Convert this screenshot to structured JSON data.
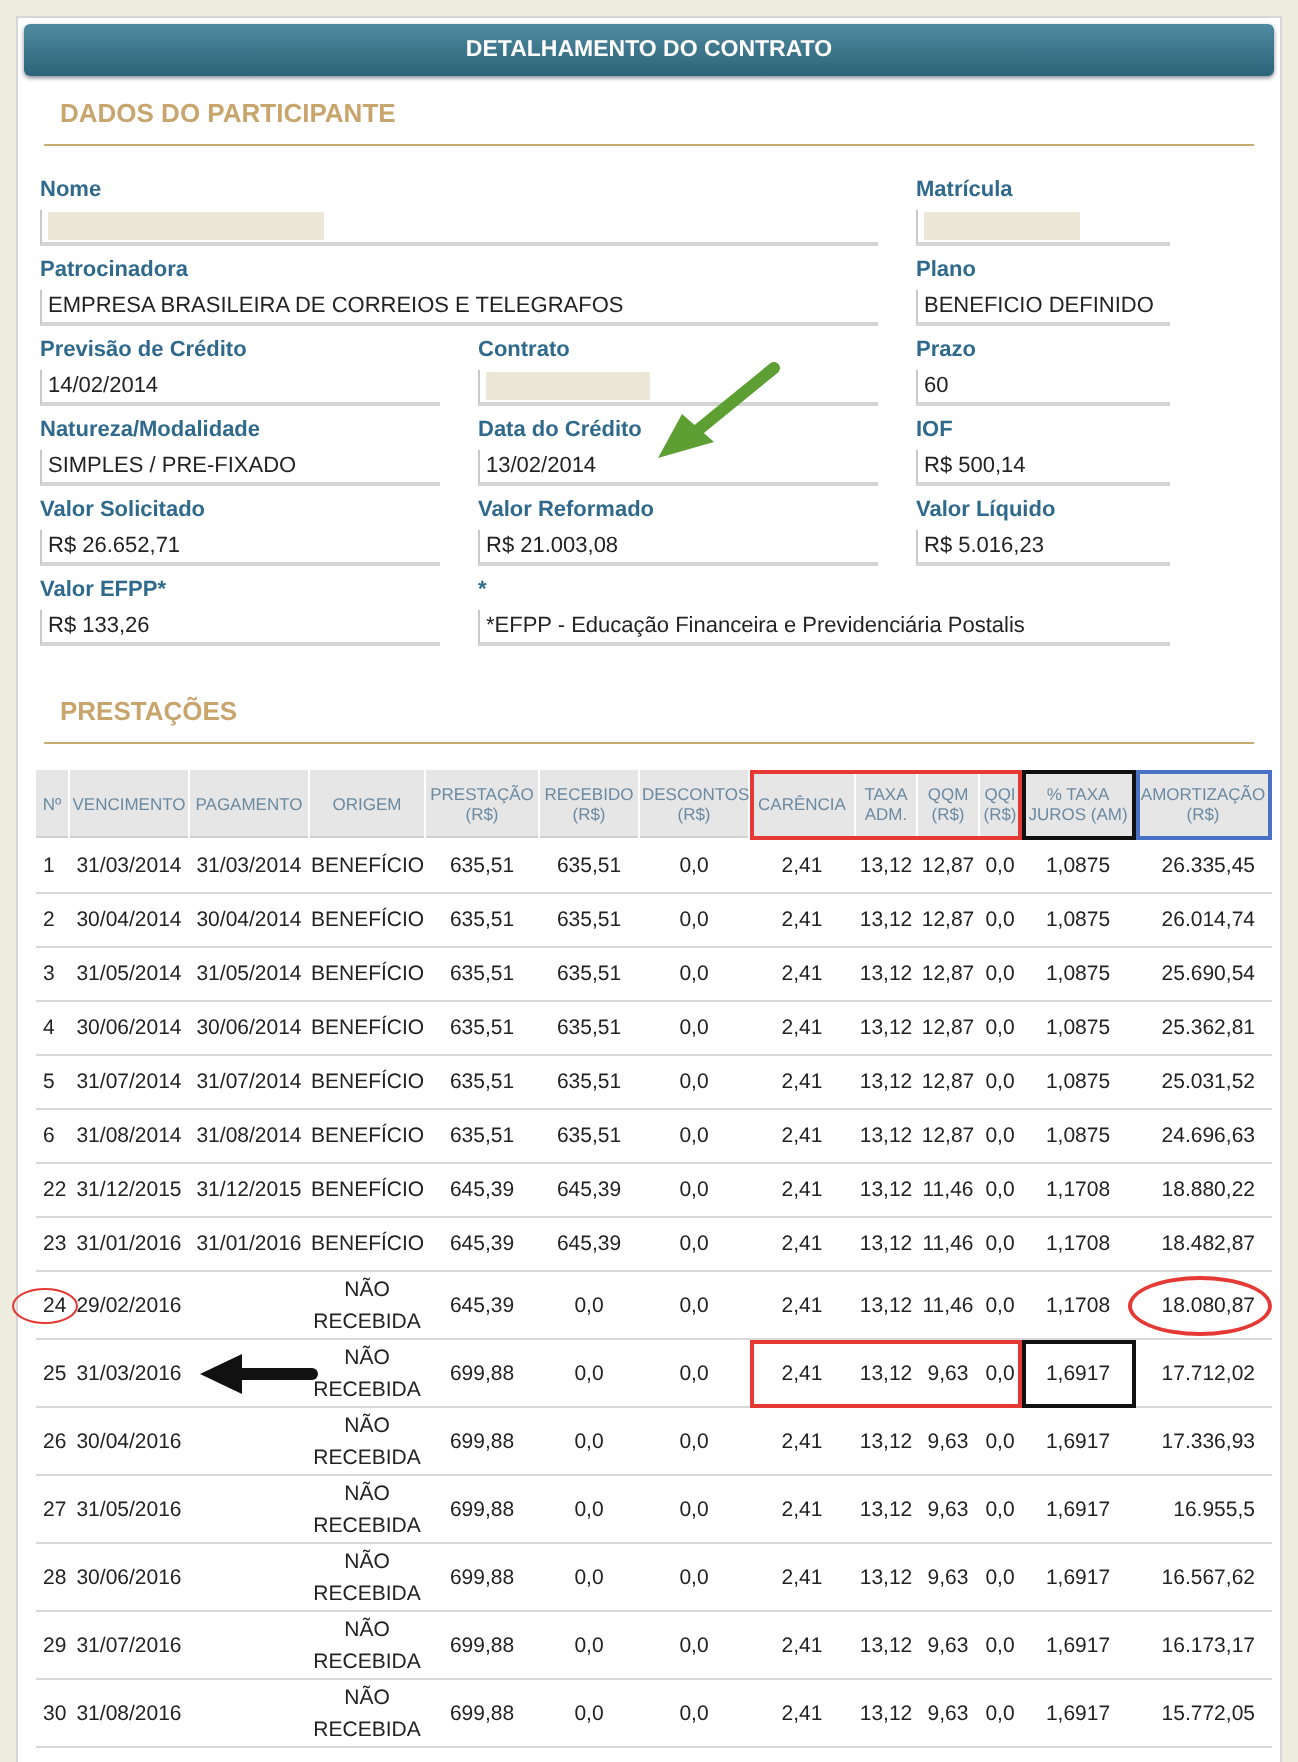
{
  "header": {
    "title": "DETALHAMENTO DO CONTRATO"
  },
  "participant": {
    "title": "DADOS DO PARTICIPANTE",
    "fields": [
      {
        "label": "Nome",
        "kind": "wide",
        "redacted": true
      },
      {
        "label": "Matrícula",
        "kind": "normal",
        "redacted": true
      },
      {
        "label": "Patrocinadora",
        "kind": "wide",
        "value": "EMPRESA BRASILEIRA DE CORREIOS E TELEGRAFOS"
      },
      {
        "label": "Plano",
        "kind": "normal",
        "value": "BENEFICIO DEFINIDO"
      },
      {
        "label": "Previsão de Crédito",
        "kind": "normal",
        "value": "14/02/2014"
      },
      {
        "label": "Contrato",
        "kind": "normal",
        "redacted": true
      },
      {
        "label": "Prazo",
        "kind": "normal",
        "value": "60"
      },
      {
        "label": "Natureza/Modalidade",
        "kind": "normal",
        "value": "SIMPLES / PRE-FIXADO"
      },
      {
        "label": "Data do Crédito",
        "kind": "normal",
        "value": "13/02/2014",
        "marker": {
          "kind": "arrow",
          "color": "#5e9f33"
        }
      },
      {
        "label": "IOF",
        "kind": "normal",
        "value": "R$ 500,14"
      },
      {
        "label": "Valor Solicitado",
        "kind": "normal",
        "value": "R$ 26.652,71"
      },
      {
        "label": "Valor Reformado",
        "kind": "normal",
        "value": "R$ 21.003,08"
      },
      {
        "label": "Valor Líquido",
        "kind": "normal",
        "value": "R$ 5.016,23"
      },
      {
        "label": "Valor EFPP*",
        "kind": "normal",
        "value": "R$ 133,26"
      },
      {
        "label": "*",
        "kind": "wide",
        "value": "*EFPP - Educação Financeira e Previdenciária Postalis"
      }
    ]
  },
  "installments": {
    "title": "PRESTAÇÕES",
    "columns": [
      {
        "label": "Nº"
      },
      {
        "label": "VENCIMENTO"
      },
      {
        "label": "PAGAMENTO"
      },
      {
        "label": "ORIGEM"
      },
      {
        "label": "PRESTAÇÃO (R$)"
      },
      {
        "label": "RECEBIDO (R$)"
      },
      {
        "label": "DESCONTOS (R$)"
      },
      {
        "label": "CARÊNCIA",
        "mark": {
          "kind": "box",
          "color": "#e53935"
        }
      },
      {
        "label": "TAXA ADM.",
        "mark": {
          "kind": "box",
          "color": "#e53935"
        }
      },
      {
        "label": "QQM (R$)",
        "mark": {
          "kind": "box",
          "color": "#e53935"
        }
      },
      {
        "label": "QQI (R$)",
        "mark": {
          "kind": "box",
          "color": "#e53935"
        }
      },
      {
        "label": "% TAXA JUROS (AM)",
        "mark": {
          "kind": "box",
          "color": "#111111"
        }
      },
      {
        "label": "AMORTIZAÇÃO (R$)",
        "mark": {
          "kind": "box",
          "color": "#4a72c4"
        }
      }
    ],
    "rows": [
      {
        "n": "1",
        "vencimento": "31/03/2014",
        "pagamento": "31/03/2014",
        "origem": "BENEFÍCIO",
        "prestacao": "635,51",
        "recebido": "635,51",
        "descontos": "0,0",
        "carencia": "2,41",
        "taxa_adm": "13,12",
        "qqm": "12,87",
        "qqi": "0,0",
        "taxa_juros": "1,0875",
        "amortizacao": "26.335,45"
      },
      {
        "n": "2",
        "vencimento": "30/04/2014",
        "pagamento": "30/04/2014",
        "origem": "BENEFÍCIO",
        "prestacao": "635,51",
        "recebido": "635,51",
        "descontos": "0,0",
        "carencia": "2,41",
        "taxa_adm": "13,12",
        "qqm": "12,87",
        "qqi": "0,0",
        "taxa_juros": "1,0875",
        "amortizacao": "26.014,74"
      },
      {
        "n": "3",
        "vencimento": "31/05/2014",
        "pagamento": "31/05/2014",
        "origem": "BENEFÍCIO",
        "prestacao": "635,51",
        "recebido": "635,51",
        "descontos": "0,0",
        "carencia": "2,41",
        "taxa_adm": "13,12",
        "qqm": "12,87",
        "qqi": "0,0",
        "taxa_juros": "1,0875",
        "amortizacao": "25.690,54"
      },
      {
        "n": "4",
        "vencimento": "30/06/2014",
        "pagamento": "30/06/2014",
        "origem": "BENEFÍCIO",
        "prestacao": "635,51",
        "recebido": "635,51",
        "descontos": "0,0",
        "carencia": "2,41",
        "taxa_adm": "13,12",
        "qqm": "12,87",
        "qqi": "0,0",
        "taxa_juros": "1,0875",
        "amortizacao": "25.362,81"
      },
      {
        "n": "5",
        "vencimento": "31/07/2014",
        "pagamento": "31/07/2014",
        "origem": "BENEFÍCIO",
        "prestacao": "635,51",
        "recebido": "635,51",
        "descontos": "0,0",
        "carencia": "2,41",
        "taxa_adm": "13,12",
        "qqm": "12,87",
        "qqi": "0,0",
        "taxa_juros": "1,0875",
        "amortizacao": "25.031,52"
      },
      {
        "n": "6",
        "vencimento": "31/08/2014",
        "pagamento": "31/08/2014",
        "origem": "BENEFÍCIO",
        "prestacao": "635,51",
        "recebido": "635,51",
        "descontos": "0,0",
        "carencia": "2,41",
        "taxa_adm": "13,12",
        "qqm": "12,87",
        "qqi": "0,0",
        "taxa_juros": "1,0875",
        "amortizacao": "24.696,63"
      },
      {
        "n": "22",
        "vencimento": "31/12/2015",
        "pagamento": "31/12/2015",
        "origem": "BENEFÍCIO",
        "prestacao": "645,39",
        "recebido": "645,39",
        "descontos": "0,0",
        "carencia": "2,41",
        "taxa_adm": "13,12",
        "qqm": "11,46",
        "qqi": "0,0",
        "taxa_juros": "1,1708",
        "amortizacao": "18.880,22"
      },
      {
        "n": "23",
        "vencimento": "31/01/2016",
        "pagamento": "31/01/2016",
        "origem": "BENEFÍCIO",
        "prestacao": "645,39",
        "recebido": "645,39",
        "descontos": "0,0",
        "carencia": "2,41",
        "taxa_adm": "13,12",
        "qqm": "11,46",
        "qqi": "0,0",
        "taxa_juros": "1,1708",
        "amortizacao": "18.482,87"
      },
      {
        "n": "24",
        "vencimento": "29/02/2016",
        "origem": "NÃO RECEBIDA",
        "prestacao": "645,39",
        "recebido": "0,0",
        "descontos": "0,0",
        "carencia": "2,41",
        "taxa_adm": "13,12",
        "qqm": "11,46",
        "qqi": "0,0",
        "taxa_juros": "1,1708",
        "amortizacao": "18.080,87",
        "marks": {
          "n": {
            "kind": "ellipse",
            "color": "#e53935"
          },
          "amortizacao": {
            "kind": "ellipse",
            "color": "#e53935"
          }
        }
      },
      {
        "n": "25",
        "vencimento": "31/03/2016",
        "origem": "NÃO RECEBIDA",
        "prestacao": "699,88",
        "recebido": "0,0",
        "descontos": "0,0",
        "carencia": "2,41",
        "taxa_adm": "13,12",
        "qqm": "9,63",
        "qqi": "0,0",
        "taxa_juros": "1,6917",
        "amortizacao": "17.712,02",
        "marks": {
          "pagamento": {
            "kind": "arrow",
            "color": "#111111"
          },
          "carencia": {
            "kind": "box",
            "color": "#e53935"
          },
          "taxa_adm": {
            "kind": "box",
            "color": "#e53935"
          },
          "qqm": {
            "kind": "box",
            "color": "#e53935"
          },
          "qqi": {
            "kind": "box",
            "color": "#e53935"
          },
          "taxa_juros": {
            "kind": "box",
            "color": "#111111"
          }
        }
      },
      {
        "n": "26",
        "vencimento": "30/04/2016",
        "origem": "NÃO RECEBIDA",
        "prestacao": "699,88",
        "recebido": "0,0",
        "descontos": "0,0",
        "carencia": "2,41",
        "taxa_adm": "13,12",
        "qqm": "9,63",
        "qqi": "0,0",
        "taxa_juros": "1,6917",
        "amortizacao": "17.336,93"
      },
      {
        "n": "27",
        "vencimento": "31/05/2016",
        "origem": "NÃO RECEBIDA",
        "prestacao": "699,88",
        "recebido": "0,0",
        "descontos": "0,0",
        "carencia": "2,41",
        "taxa_adm": "13,12",
        "qqm": "9,63",
        "qqi": "0,0",
        "taxa_juros": "1,6917",
        "amortizacao": "16.955,5"
      },
      {
        "n": "28",
        "vencimento": "30/06/2016",
        "origem": "NÃO RECEBIDA",
        "prestacao": "699,88",
        "recebido": "0,0",
        "descontos": "0,0",
        "carencia": "2,41",
        "taxa_adm": "13,12",
        "qqm": "9,63",
        "qqi": "0,0",
        "taxa_juros": "1,6917",
        "amortizacao": "16.567,62"
      },
      {
        "n": "29",
        "vencimento": "31/07/2016",
        "origem": "NÃO RECEBIDA",
        "prestacao": "699,88",
        "recebido": "0,0",
        "descontos": "0,0",
        "carencia": "2,41",
        "taxa_adm": "13,12",
        "qqm": "9,63",
        "qqi": "0,0",
        "taxa_juros": "1,6917",
        "amortizacao": "16.173,17"
      },
      {
        "n": "30",
        "vencimento": "31/08/2016",
        "origem": "NÃO RECEBIDA",
        "prestacao": "699,88",
        "recebido": "0,0",
        "descontos": "0,0",
        "carencia": "2,41",
        "taxa_adm": "13,12",
        "qqm": "9,63",
        "qqi": "0,0",
        "taxa_juros": "1,6917",
        "amortizacao": "15.772,05"
      }
    ]
  }
}
